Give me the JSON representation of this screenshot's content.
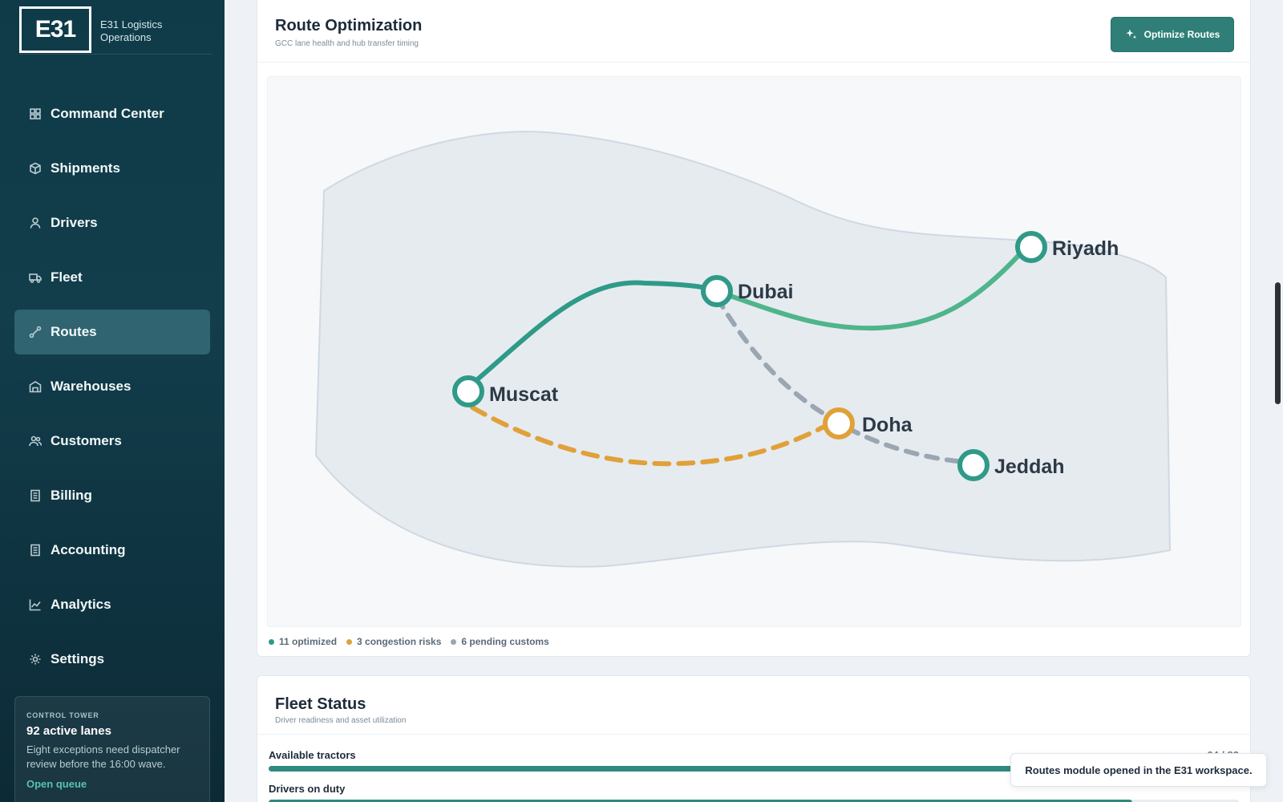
{
  "brand": {
    "logo": "E31",
    "name_line1": "E31 Logistics",
    "name_line2": "Operations"
  },
  "sidebar": {
    "items": [
      {
        "label": "Command Center",
        "icon": "grid-icon"
      },
      {
        "label": "Shipments",
        "icon": "box-icon"
      },
      {
        "label": "Drivers",
        "icon": "user-icon"
      },
      {
        "label": "Fleet",
        "icon": "truck-icon"
      },
      {
        "label": "Routes",
        "icon": "route-icon",
        "active": true
      },
      {
        "label": "Warehouses",
        "icon": "warehouse-icon"
      },
      {
        "label": "Customers",
        "icon": "users-icon"
      },
      {
        "label": "Billing",
        "icon": "receipt-icon"
      },
      {
        "label": "Accounting",
        "icon": "ledger-icon"
      },
      {
        "label": "Analytics",
        "icon": "chart-icon"
      },
      {
        "label": "Settings",
        "icon": "gear-icon"
      }
    ],
    "control_tower": {
      "kicker": "CONTROL TOWER",
      "title": "92 active lanes",
      "description": "Eight exceptions need dispatcher review before the 16:00 wave.",
      "link": "Open queue"
    }
  },
  "route_optimization": {
    "title": "Route Optimization",
    "subtitle": "GCC lane health and hub transfer timing",
    "button_label": "Optimize Routes",
    "hubs": [
      {
        "name": "Riyadh",
        "status": "optimized"
      },
      {
        "name": "Dubai",
        "status": "optimized"
      },
      {
        "name": "Muscat",
        "status": "optimized"
      },
      {
        "name": "Doha",
        "status": "congestion"
      },
      {
        "name": "Jeddah",
        "status": "optimized"
      }
    ],
    "lanes": [
      {
        "from": "Muscat",
        "to": "Dubai",
        "status": "optimized"
      },
      {
        "from": "Dubai",
        "to": "Riyadh",
        "status": "optimized"
      },
      {
        "from": "Muscat",
        "to": "Doha",
        "status": "congestion"
      },
      {
        "from": "Dubai",
        "to": "Jeddah",
        "status": "pending"
      }
    ],
    "legend": [
      {
        "label": "11 optimized",
        "color": "#2f9a88"
      },
      {
        "label": "3 congestion risks",
        "color": "#e0a13a"
      },
      {
        "label": "6 pending customs",
        "color": "#9aa6b2"
      }
    ]
  },
  "fleet_status": {
    "title": "Fleet Status",
    "subtitle": "Driver readiness and asset utilization",
    "metrics": [
      {
        "label": "Available tractors",
        "value": "64 / 82",
        "fraction": 0.78
      },
      {
        "label": "Drivers on duty",
        "value": "",
        "fraction": 0.89
      }
    ]
  },
  "toast": {
    "message": "Routes module opened in the E31 workspace."
  },
  "colors": {
    "accent": "#2f7f78",
    "optimized": "#2f9a88",
    "congestion": "#e0a13a",
    "pending": "#9aa6b2"
  }
}
